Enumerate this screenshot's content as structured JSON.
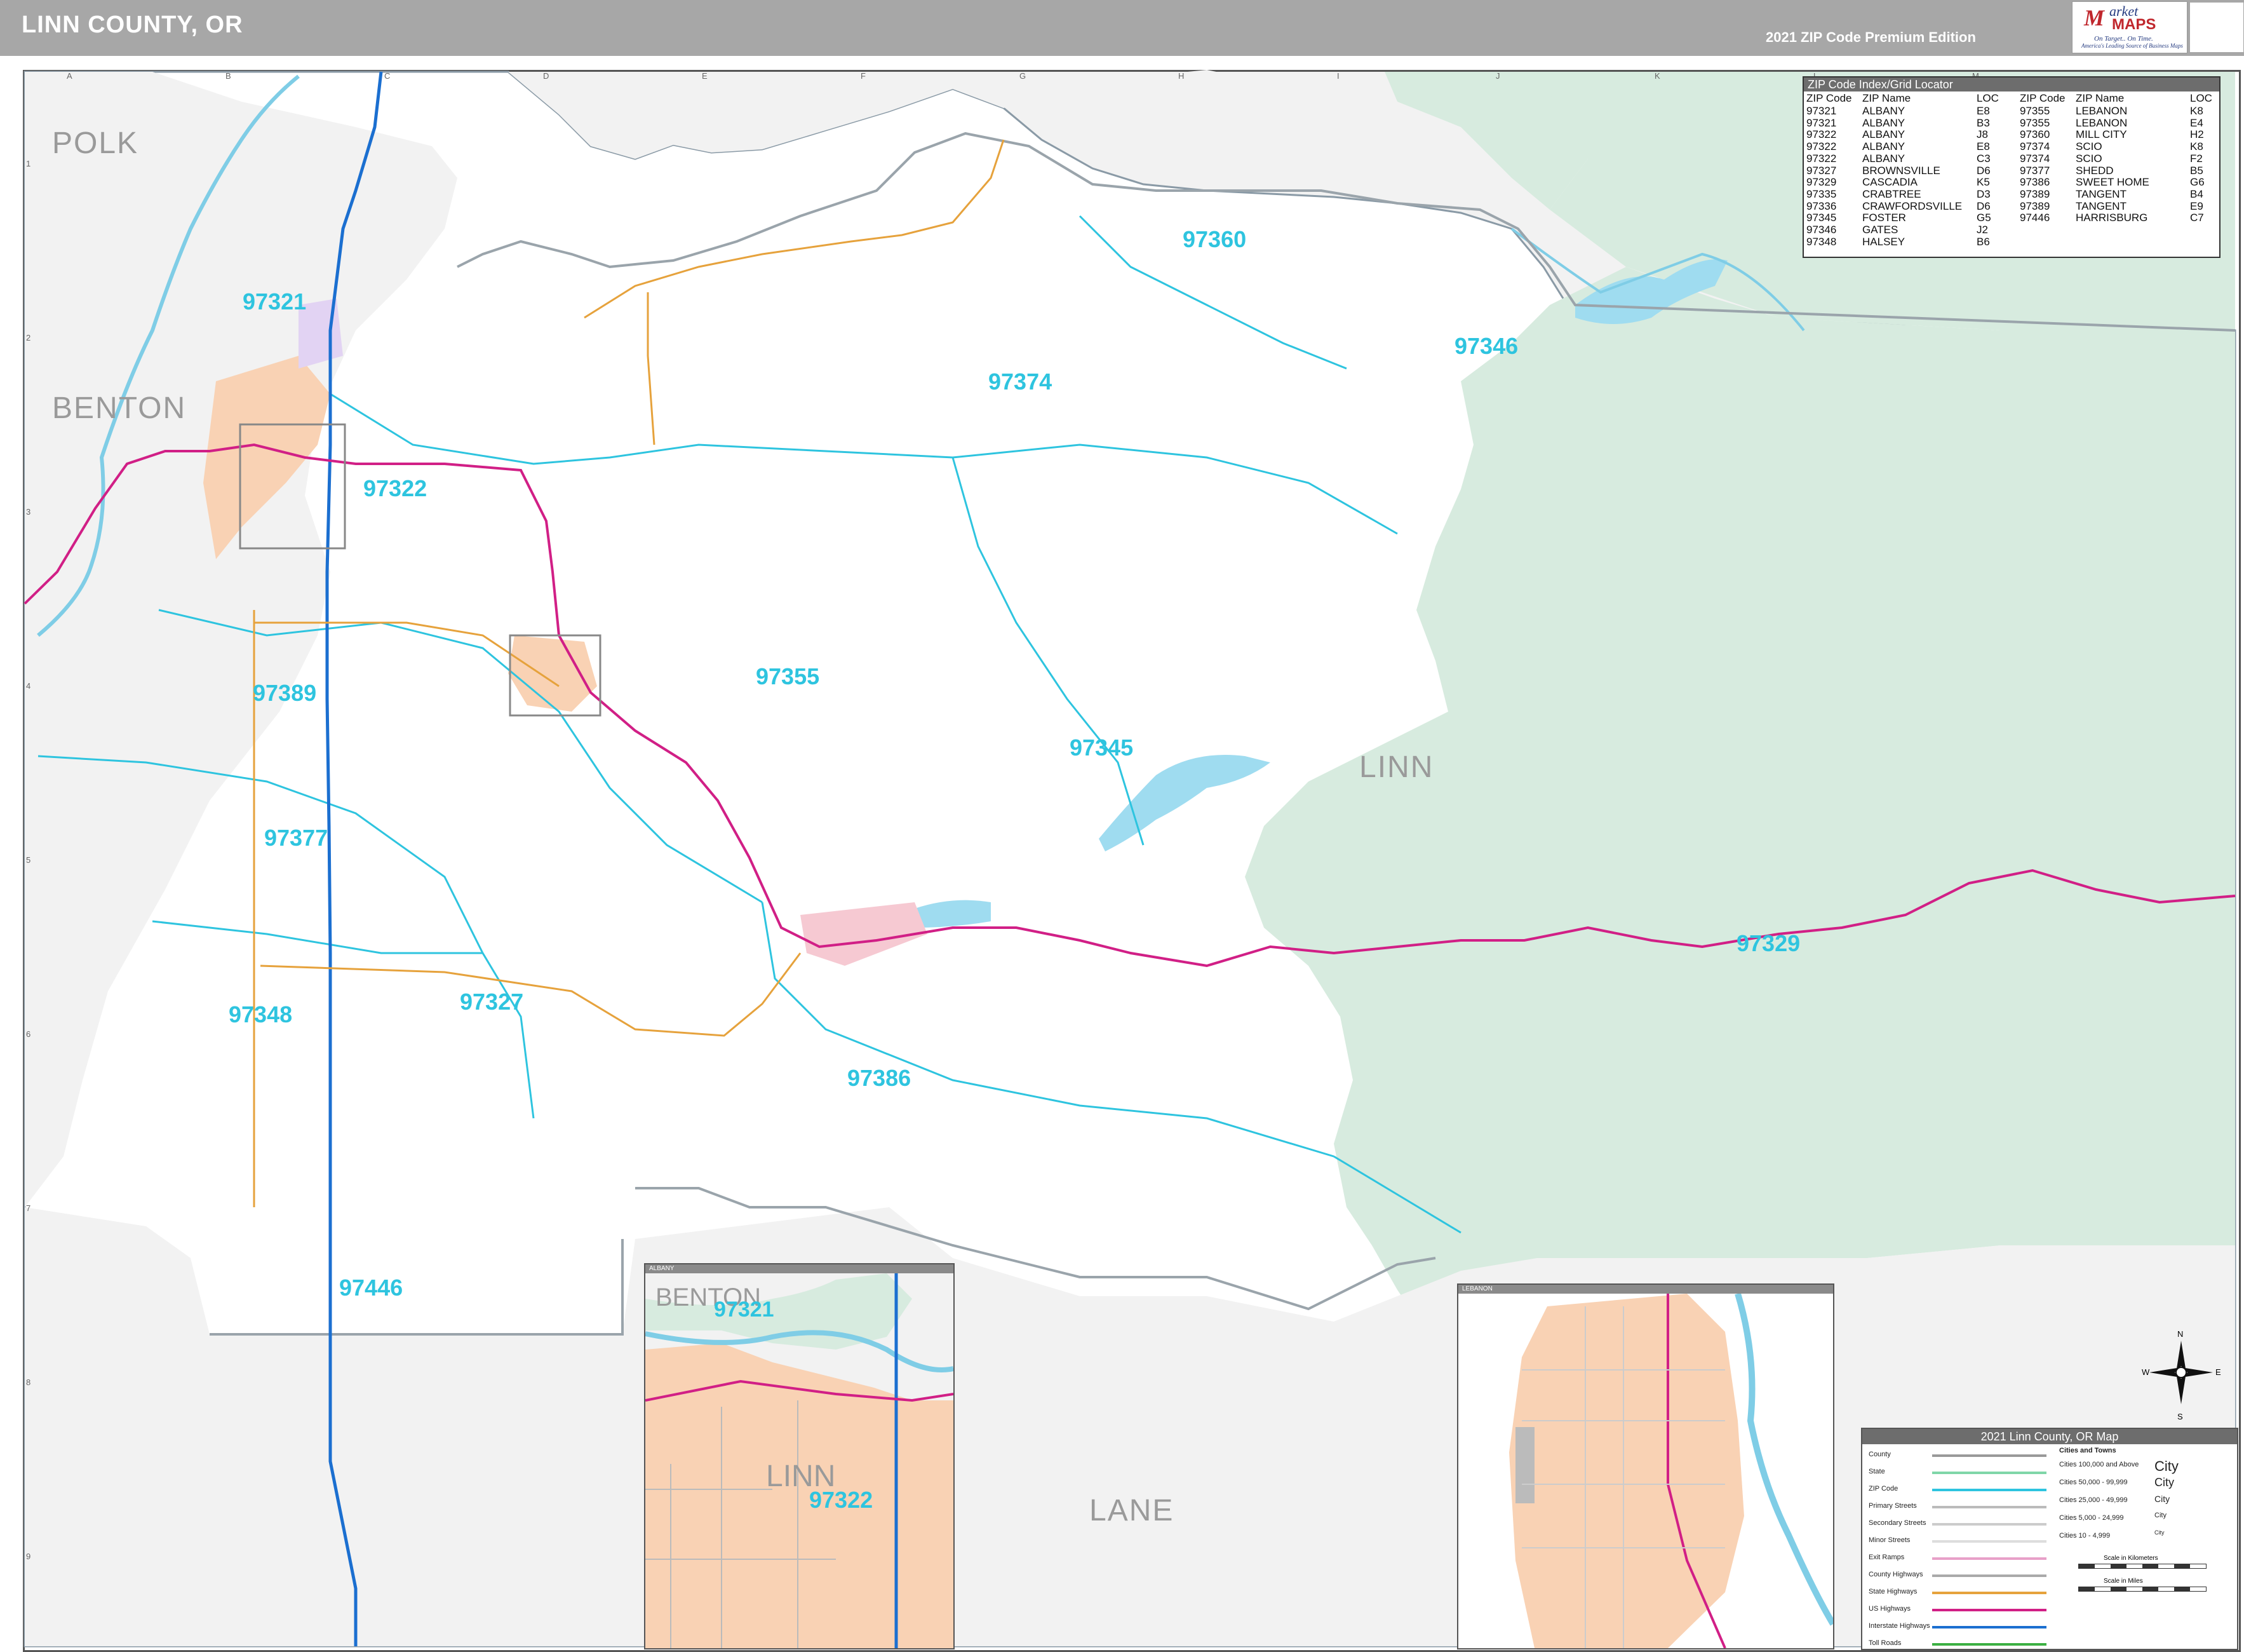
{
  "header": {
    "title": "LINN COUNTY, OR",
    "edition": "2021 ZIP Code Premium Edition"
  },
  "logo": {
    "brand_m": "M",
    "brand_market": "arket",
    "brand_maps": "MAPS",
    "tagline": "On Target.. On Time.",
    "subtagline": "America's Leading Source of Business Maps"
  },
  "grid": {
    "columns": [
      "A",
      "B",
      "C",
      "D",
      "E",
      "F",
      "G",
      "H",
      "I",
      "J",
      "K",
      "L",
      "M"
    ],
    "rows": [
      "1",
      "2",
      "3",
      "4",
      "5",
      "6",
      "7",
      "8",
      "9"
    ]
  },
  "counties": {
    "polk": "POLK",
    "benton": "BENTON",
    "linn": "LINN",
    "lane": "LANE"
  },
  "zip_labels": [
    "97321",
    "97322",
    "97389",
    "97377",
    "97348",
    "97327",
    "97446",
    "97374",
    "97355",
    "97345",
    "97360",
    "97346",
    "97329",
    "97386"
  ],
  "zip_index": {
    "title": "ZIP Code Index/Grid Locator",
    "columns": [
      "ZIP Code",
      "ZIP Name",
      "LOC",
      "ZIP Code",
      "ZIP Name",
      "LOC"
    ],
    "left": [
      {
        "zip": "97321",
        "name": "ALBANY",
        "loc": "E8"
      },
      {
        "zip": "97321",
        "name": "ALBANY",
        "loc": "B3"
      },
      {
        "zip": "97322",
        "name": "ALBANY",
        "loc": "J8"
      },
      {
        "zip": "97322",
        "name": "ALBANY",
        "loc": "E8"
      },
      {
        "zip": "97322",
        "name": "ALBANY",
        "loc": "C3"
      },
      {
        "zip": "97327",
        "name": "BROWNSVILLE",
        "loc": "D6"
      },
      {
        "zip": "97329",
        "name": "CASCADIA",
        "loc": "K5"
      },
      {
        "zip": "97335",
        "name": "CRABTREE",
        "loc": "D3"
      },
      {
        "zip": "97336",
        "name": "CRAWFORDSVILLE",
        "loc": "D6"
      },
      {
        "zip": "97345",
        "name": "FOSTER",
        "loc": "G5"
      },
      {
        "zip": "97346",
        "name": "GATES",
        "loc": "J2"
      },
      {
        "zip": "97348",
        "name": "HALSEY",
        "loc": "B6"
      }
    ],
    "right": [
      {
        "zip": "97355",
        "name": "LEBANON",
        "loc": "K8"
      },
      {
        "zip": "97355",
        "name": "LEBANON",
        "loc": "E4"
      },
      {
        "zip": "97360",
        "name": "MILL CITY",
        "loc": "H2"
      },
      {
        "zip": "97374",
        "name": "SCIO",
        "loc": "K8"
      },
      {
        "zip": "97374",
        "name": "SCIO",
        "loc": "F2"
      },
      {
        "zip": "97377",
        "name": "SHEDD",
        "loc": "B5"
      },
      {
        "zip": "97386",
        "name": "SWEET HOME",
        "loc": "G6"
      },
      {
        "zip": "97389",
        "name": "TANGENT",
        "loc": "B4"
      },
      {
        "zip": "97389",
        "name": "TANGENT",
        "loc": "E9"
      },
      {
        "zip": "97446",
        "name": "HARRISBURG",
        "loc": "C7"
      }
    ]
  },
  "insets": {
    "albany_bar": "ALBANY",
    "albany_labels": {
      "benton": "BENTON",
      "zip1": "97321",
      "linn": "LINN",
      "zip2": "97322"
    },
    "lebanon_bar": "LEBANON"
  },
  "legend": {
    "title": "2021 Linn County, OR Map",
    "items": [
      "County",
      "State",
      "ZIP Code",
      "Primary Streets",
      "Secondary Streets",
      "Minor Streets",
      "Exit Ramps",
      "County Highways",
      "State Highways",
      "US Highways",
      "Interstate Highways",
      "Toll Roads"
    ],
    "cities_title": "Cities and Towns",
    "cities": [
      {
        "range": "Cities 100,000 and Above",
        "sample": "City"
      },
      {
        "range": "Cities 50,000 - 99,999",
        "sample": "City"
      },
      {
        "range": "Cities 25,000 - 49,999",
        "sample": "City"
      },
      {
        "range": "Cities 5,000 - 24,999",
        "sample": "City"
      },
      {
        "range": "Cities 10 - 4,999",
        "sample": "City"
      }
    ],
    "scale_km": "Scale in Kilometers",
    "scale_mi": "Scale in Miles"
  },
  "compass": {
    "n": "N",
    "s": "S",
    "e": "E",
    "w": "W"
  },
  "colors": {
    "water": "#9fdcf0",
    "forest": "#d7ebdf",
    "urban": "#f9d2b4",
    "zip_line": "#2ec4df",
    "us_highway": "#d11f86",
    "interstate": "#1b6fd0",
    "state_highway": "#e6a23c",
    "county_outside": "#f2f2f2"
  }
}
